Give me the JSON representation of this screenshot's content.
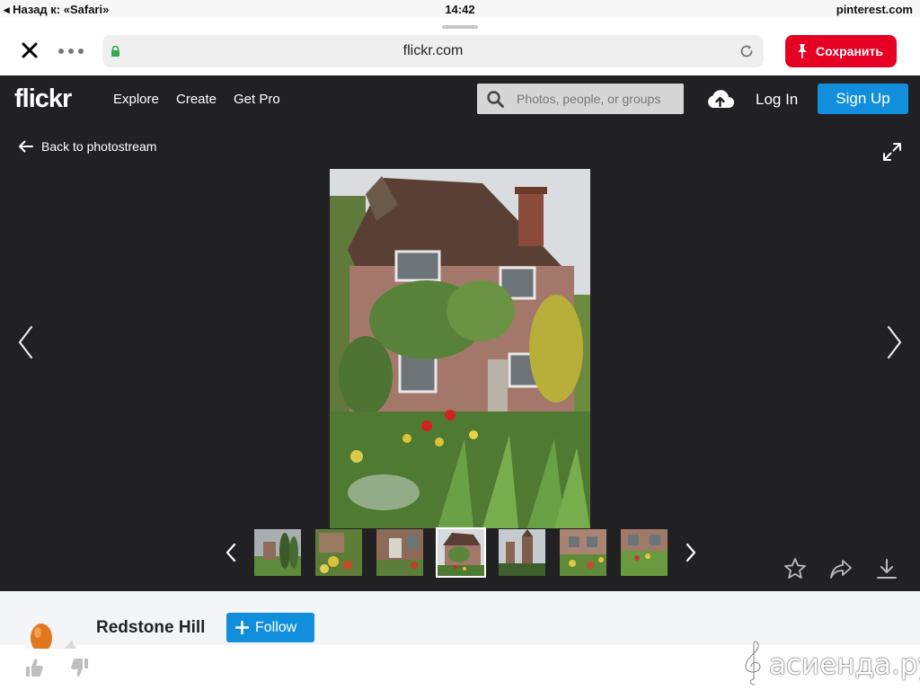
{
  "status_bar": {
    "back_label": "◂ Назад к: «Safari»",
    "time": "14:42",
    "source": "pinterest.com"
  },
  "browser": {
    "url": "flickr.com",
    "save_label": "Сохранить",
    "accent": "#e60023"
  },
  "flickr_nav": {
    "logo": "flickr",
    "links": [
      "Explore",
      "Create",
      "Get Pro"
    ],
    "search_placeholder": "Photos, people, or groups",
    "login": "Log In",
    "signup": "Sign Up",
    "accent": "#128fdc"
  },
  "viewer": {
    "back_label": "Back to photostream",
    "thumbnail_count": 7,
    "active_thumbnail": 4,
    "actions": [
      "star-icon",
      "share-icon",
      "download-icon"
    ]
  },
  "author": {
    "name": "Redstone Hill",
    "follow_label": "Follow"
  },
  "watermark": {
    "text": "асиенда.ру"
  }
}
